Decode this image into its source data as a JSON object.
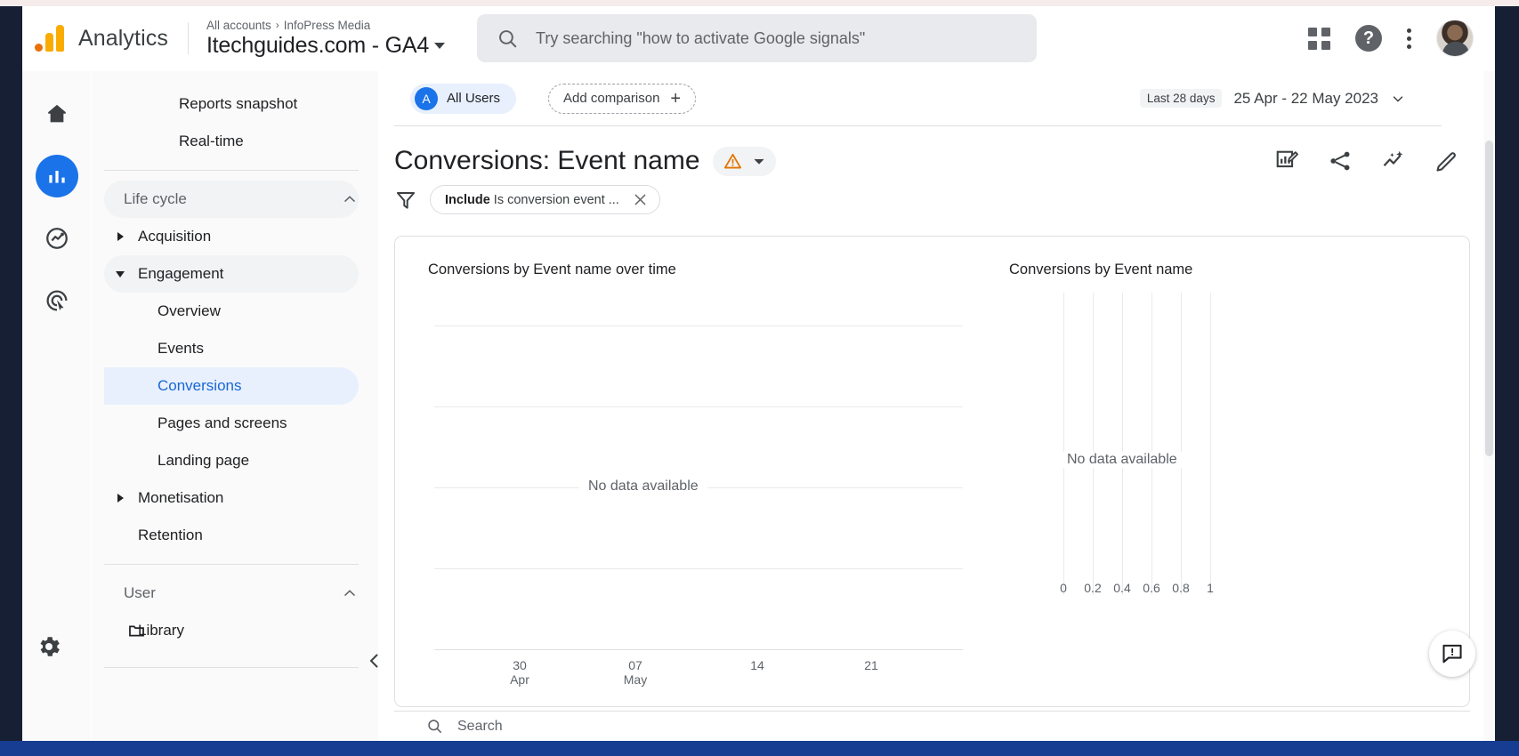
{
  "header": {
    "logo_icon": "google-analytics-logo",
    "brand": "Analytics",
    "breadcrumb_root": "All accounts",
    "breadcrumb_sep": "›",
    "breadcrumb_account": "InfoPress Media",
    "property_name": "Itechguides.com - GA4",
    "search_placeholder": "Try searching \"how to activate Google signals\"",
    "search_icon": "search-icon",
    "apps_icon": "apps-grid-icon",
    "help_icon": "help-icon",
    "help_glyph": "?",
    "more_icon": "more-vert-icon",
    "avatar_icon": "user-avatar"
  },
  "rail": {
    "items": [
      {
        "name": "home-icon",
        "label": "Home",
        "active": false
      },
      {
        "name": "reports-icon",
        "label": "Reports",
        "active": true
      },
      {
        "name": "explore-icon",
        "label": "Explore",
        "active": false
      },
      {
        "name": "advertising-icon",
        "label": "Advertising",
        "active": false
      }
    ],
    "settings_icon": "gear-icon",
    "settings_label": "Admin"
  },
  "sidebar": {
    "items": [
      {
        "label": "Reports snapshot",
        "type": "item",
        "selected": false
      },
      {
        "label": "Real-time",
        "type": "item",
        "selected": false
      },
      {
        "label": "Life cycle",
        "type": "section",
        "expanded": true,
        "selected": false
      },
      {
        "label": "Acquisition",
        "type": "group",
        "expanded": false,
        "selected": false
      },
      {
        "label": "Engagement",
        "type": "group",
        "expanded": true,
        "selected": false
      },
      {
        "label": "Overview",
        "type": "sub",
        "selected": false
      },
      {
        "label": "Events",
        "type": "sub",
        "selected": false
      },
      {
        "label": "Conversions",
        "type": "sub",
        "selected": true
      },
      {
        "label": "Pages and screens",
        "type": "sub",
        "selected": false
      },
      {
        "label": "Landing page",
        "type": "sub",
        "selected": false
      },
      {
        "label": "Monetisation",
        "type": "group",
        "expanded": false,
        "selected": false
      },
      {
        "label": "Retention",
        "type": "item-indent",
        "selected": false
      },
      {
        "label": "User",
        "type": "section",
        "expanded": true,
        "selected": false
      },
      {
        "label": "Library",
        "type": "library",
        "icon": "folder-icon",
        "selected": false
      }
    ],
    "collapse_icon": "chevron-left-icon",
    "collapse_label": "Collapse navigation"
  },
  "toolbar": {
    "audience_badge": "A",
    "audience_label": "All Users",
    "add_comparison_label": "Add comparison",
    "add_comparison_icon": "plus-icon",
    "date_preset": "Last 28 days",
    "date_range": "25 Apr - 22 May 2023",
    "date_caret_icon": "chevron-down-icon"
  },
  "report": {
    "title": "Conversions: Event name",
    "warning_icon": "warning-triangle-icon",
    "warning_caret_icon": "chevron-down-icon",
    "filter_icon": "filter-icon",
    "filter_prefix": "Include",
    "filter_text": "Is conversion event ...",
    "filter_remove_icon": "close-icon",
    "actions": [
      {
        "name": "customise-report-icon",
        "label": "Customise report"
      },
      {
        "name": "share-icon",
        "label": "Share this report"
      },
      {
        "name": "insights-icon",
        "label": "Insights"
      },
      {
        "name": "edit-icon",
        "label": "Edit"
      }
    ]
  },
  "chart_data": [
    {
      "type": "line",
      "title": "Conversions by Event name over time",
      "xlabel": "",
      "ylabel": "",
      "empty_message": "No data available",
      "x_ticks": [
        {
          "line1": "30",
          "line2": "Apr"
        },
        {
          "line1": "07",
          "line2": "May"
        },
        {
          "line1": "14",
          "line2": ""
        },
        {
          "line1": "21",
          "line2": ""
        }
      ],
      "series": [],
      "grid": true,
      "legend": "none"
    },
    {
      "type": "bar",
      "title": "Conversions by Event name",
      "orientation": "horizontal",
      "xlabel": "",
      "ylabel": "",
      "empty_message": "No data available",
      "x_ticks": [
        "0",
        "0.2",
        "0.4",
        "0.6",
        "0.8",
        "1"
      ],
      "xlim": [
        0,
        1
      ],
      "categories": [],
      "values": [],
      "grid": true,
      "legend": "none"
    }
  ],
  "footer": {
    "search_icon": "search-icon",
    "search_label": "Search",
    "feedback_icon": "feedback-icon",
    "feedback_label": "Send feedback"
  },
  "colors": {
    "accent": "#1a73e8",
    "selected_bg": "#e8f0fe",
    "warning": "#e37400",
    "logo_orange": "#e8710a",
    "logo_yellow": "#f9ab00"
  }
}
